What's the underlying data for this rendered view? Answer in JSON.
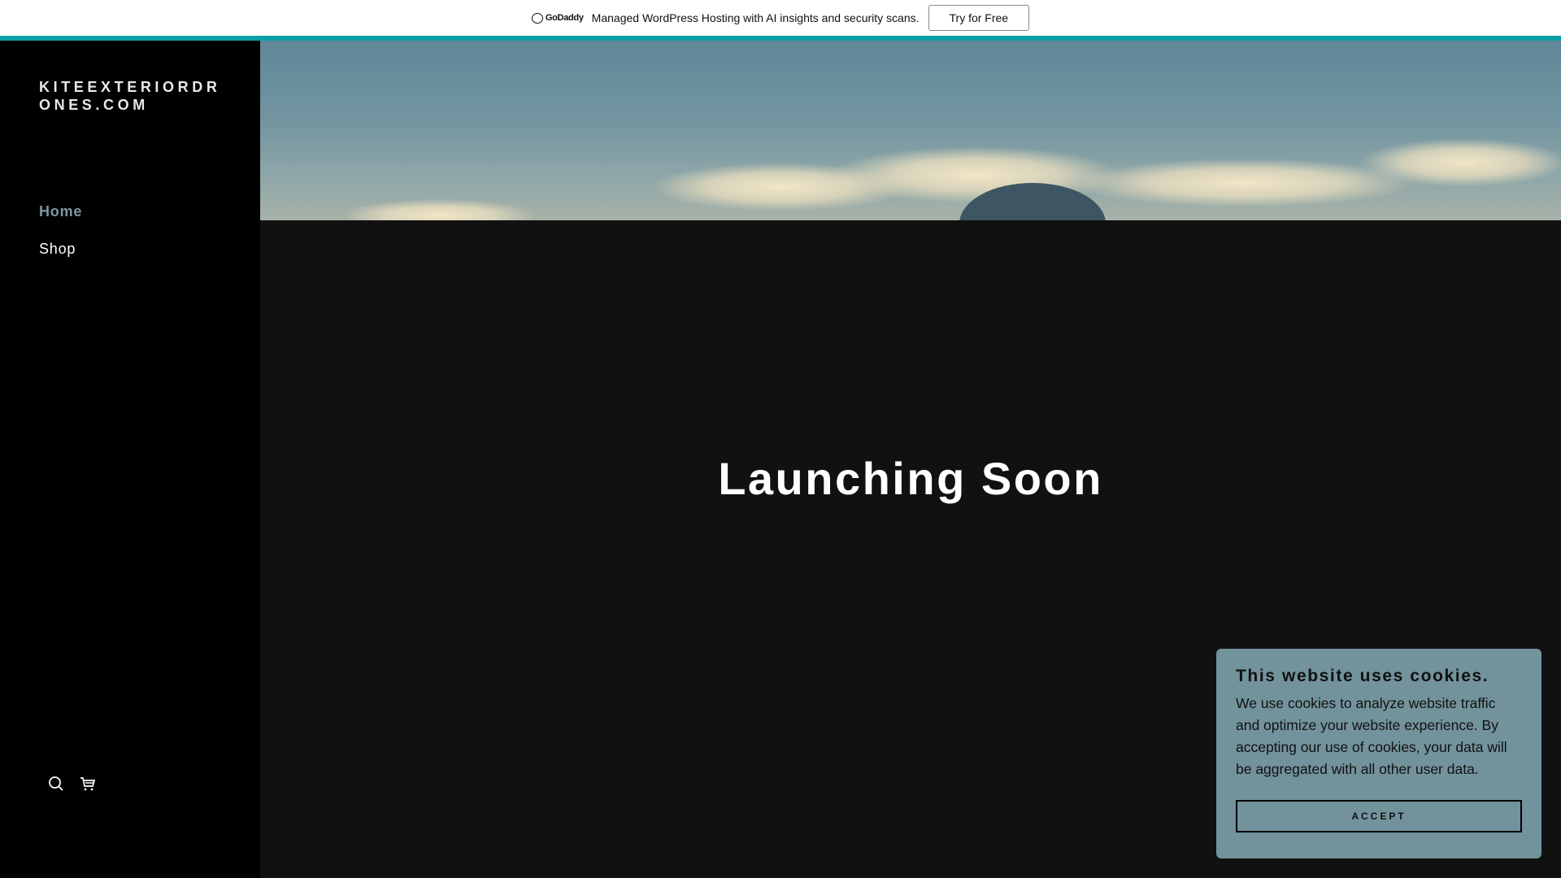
{
  "banner": {
    "brand": "GoDaddy",
    "message": "Managed WordPress Hosting with AI insights and security scans.",
    "cta": "Try for Free"
  },
  "sidebar": {
    "site_name": "KITEEXTERIORDRONES.COM",
    "nav": [
      {
        "label": "Home",
        "active": true
      },
      {
        "label": "Shop",
        "active": false
      }
    ],
    "icons": [
      "search-icon",
      "cart-icon"
    ]
  },
  "main": {
    "title": "Launching Soon"
  },
  "cookie": {
    "title": "This website uses cookies.",
    "body": "We use cookies to analyze website traffic and optimize your website experience. By accepting our use of cookies, your data will be aggregated with all other user data.",
    "accept": "ACCEPT"
  },
  "colors": {
    "accent": "#09a0a6",
    "nav_active": "#7c97a1",
    "cookie_bg": "#72929c"
  }
}
